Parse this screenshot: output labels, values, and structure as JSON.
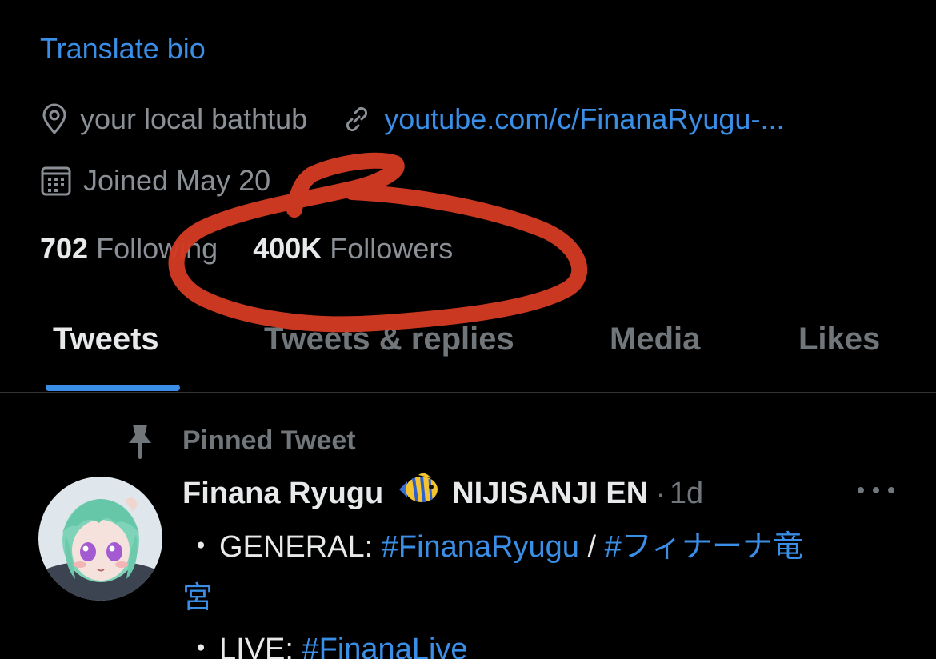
{
  "bio": {
    "translate_label": "Translate bio"
  },
  "meta": {
    "location": "your local bathtub",
    "website": "youtube.com/c/FinanaRyugu-...",
    "joined": "Joined May 20"
  },
  "stats": {
    "following_count": "702",
    "following_label": "Following",
    "followers_count": "400K",
    "followers_label": "Followers"
  },
  "tabs": [
    {
      "label": "Tweets",
      "active": true
    },
    {
      "label": "Tweets & replies",
      "active": false
    },
    {
      "label": "Media",
      "active": false
    },
    {
      "label": "Likes",
      "active": false
    }
  ],
  "pinned": {
    "label": "Pinned Tweet"
  },
  "tweet": {
    "name_part1": "Finana Ryugu",
    "name_part2": "NIJISANJI EN",
    "separator": "·",
    "time": "1d",
    "lines": {
      "l1_bullet": "・",
      "l1_prefix": "GENERAL: ",
      "l1_tag1": "#FinanaRyugu",
      "l1_sep": " / ",
      "l1_tag2": "#フィナーナ竜",
      "l2_tag2_cont": "宮",
      "l3_bullet": "・",
      "l3_prefix": "LIVE: ",
      "l3_tag": "#FinanaLive"
    }
  },
  "colors": {
    "accent": "#3a8ee6",
    "annotation": "#d23a22",
    "background": "#000000"
  },
  "icons": {
    "location": "map-pin-icon",
    "website": "link-icon",
    "joined": "calendar-icon",
    "pinned": "pushpin-icon",
    "emoji": "tropical-fish-emoji",
    "more": "more-dots-icon"
  }
}
